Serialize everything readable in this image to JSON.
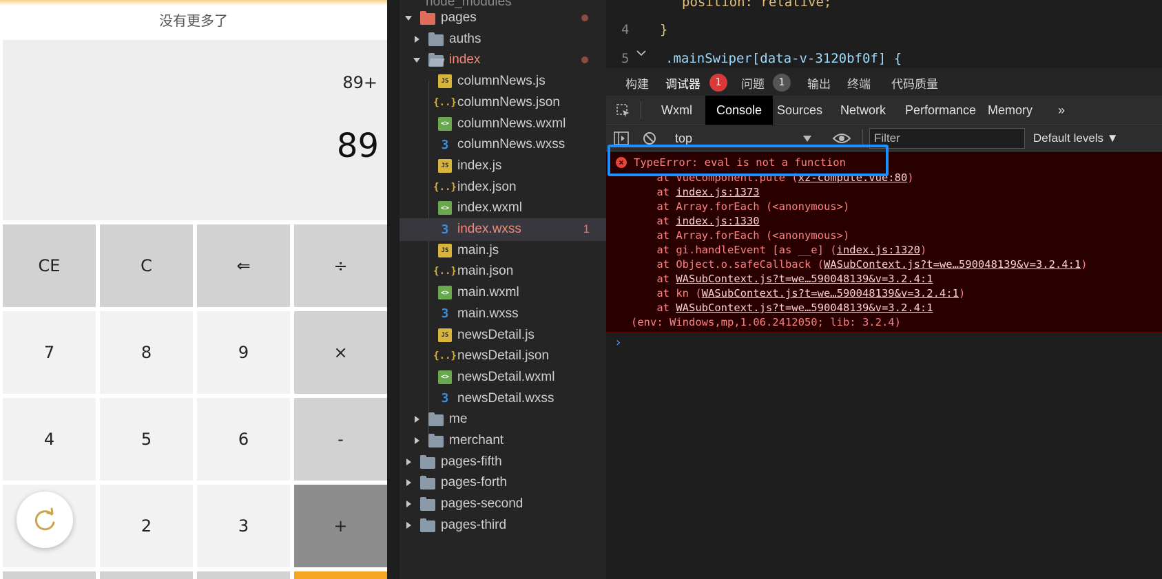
{
  "phone": {
    "no_more": "没有更多了",
    "expression": "89+",
    "result": "89",
    "keys": [
      {
        "label": "CE",
        "type": "fn"
      },
      {
        "label": "C",
        "type": "fn"
      },
      {
        "label": "⇐",
        "type": "fn"
      },
      {
        "label": "÷",
        "type": "op"
      },
      {
        "label": "7",
        "type": "num"
      },
      {
        "label": "8",
        "type": "num"
      },
      {
        "label": "9",
        "type": "num"
      },
      {
        "label": "×",
        "type": "op"
      },
      {
        "label": "4",
        "type": "num"
      },
      {
        "label": "5",
        "type": "num"
      },
      {
        "label": "6",
        "type": "num"
      },
      {
        "label": "-",
        "type": "op"
      },
      {
        "label": "",
        "type": "num"
      },
      {
        "label": "2",
        "type": "num"
      },
      {
        "label": "3",
        "type": "num"
      },
      {
        "label": "+",
        "type": "plus"
      }
    ],
    "refresh_icon": "refresh-icon"
  },
  "tree": {
    "items": [
      {
        "label": "pages",
        "kind": "folder-red",
        "depth": 1,
        "arrow": "down",
        "dot": true
      },
      {
        "label": "auths",
        "kind": "folder",
        "depth": 2,
        "arrow": "right"
      },
      {
        "label": "index",
        "kind": "folder-open",
        "depth": 2,
        "arrow": "down",
        "dot": true,
        "red": true
      },
      {
        "label": "columnNews.js",
        "kind": "js",
        "depth": 3
      },
      {
        "label": "columnNews.json",
        "kind": "json",
        "depth": 3
      },
      {
        "label": "columnNews.wxml",
        "kind": "wxml",
        "depth": 3
      },
      {
        "label": "columnNews.wxss",
        "kind": "wxss",
        "depth": 3
      },
      {
        "label": "index.js",
        "kind": "js",
        "depth": 3
      },
      {
        "label": "index.json",
        "kind": "json",
        "depth": 3
      },
      {
        "label": "index.wxml",
        "kind": "wxml",
        "depth": 3
      },
      {
        "label": "index.wxss",
        "kind": "wxss",
        "depth": 3,
        "selected": true,
        "red": true,
        "count": "1"
      },
      {
        "label": "main.js",
        "kind": "js",
        "depth": 3
      },
      {
        "label": "main.json",
        "kind": "json",
        "depth": 3
      },
      {
        "label": "main.wxml",
        "kind": "wxml",
        "depth": 3
      },
      {
        "label": "main.wxss",
        "kind": "wxss",
        "depth": 3
      },
      {
        "label": "newsDetail.js",
        "kind": "js",
        "depth": 3
      },
      {
        "label": "newsDetail.json",
        "kind": "json",
        "depth": 3
      },
      {
        "label": "newsDetail.wxml",
        "kind": "wxml",
        "depth": 3
      },
      {
        "label": "newsDetail.wxss",
        "kind": "wxss",
        "depth": 3
      },
      {
        "label": "me",
        "kind": "folder",
        "depth": 2,
        "arrow": "right"
      },
      {
        "label": "merchant",
        "kind": "folder",
        "depth": 2,
        "arrow": "right"
      },
      {
        "label": "pages-fifth",
        "kind": "folder",
        "depth": 1,
        "arrow": "right"
      },
      {
        "label": "pages-forth",
        "kind": "folder",
        "depth": 1,
        "arrow": "right"
      },
      {
        "label": "pages-second",
        "kind": "folder",
        "depth": 1,
        "arrow": "right"
      },
      {
        "label": "pages-third",
        "kind": "folder",
        "depth": 1,
        "arrow": "right"
      }
    ]
  },
  "editor": {
    "lines": [
      {
        "num": "4",
        "text": "}"
      },
      {
        "num": "5",
        "text": ".mainSwiper[data-v-3120bf0f] {"
      }
    ],
    "top_partial": "position: relative;"
  },
  "panel_tabs": [
    {
      "label": "构建"
    },
    {
      "label": "调试器",
      "badge": "1",
      "badge_color": "#d73a3a",
      "active": true
    },
    {
      "label": "问题",
      "badge": "1",
      "badge_color": "#555555"
    },
    {
      "label": "输出"
    },
    {
      "label": "终端"
    },
    {
      "label": "代码质量"
    }
  ],
  "devtools": {
    "tabs": [
      "Wxml",
      "Console",
      "Sources",
      "Network",
      "Performance",
      "Memory"
    ],
    "active_tab": "Console",
    "more": "»",
    "context": "top",
    "filter_placeholder": "Filter",
    "levels": "Default levels ▼"
  },
  "console": {
    "error_title": "TypeError: eval is not a function",
    "stack": [
      {
        "prefix": "    at VueComponent.pute (",
        "link": "xz-compute.vue:80",
        "suffix": ")"
      },
      {
        "prefix": "    at ",
        "link": "index.js:1373",
        "suffix": ""
      },
      {
        "prefix": "    at Array.forEach (<anonymous>)",
        "link": "",
        "suffix": ""
      },
      {
        "prefix": "    at ",
        "link": "index.js:1330",
        "suffix": ""
      },
      {
        "prefix": "    at Array.forEach (<anonymous>)",
        "link": "",
        "suffix": ""
      },
      {
        "prefix": "    at gi.handleEvent [as __e] (",
        "link": "index.js:1320",
        "suffix": ")"
      },
      {
        "prefix": "    at Object.o.safeCallback (",
        "link": "WASubContext.js?t=we…590048139&v=3.2.4:1",
        "suffix": ")"
      },
      {
        "prefix": "    at ",
        "link": "WASubContext.js?t=we…590048139&v=3.2.4:1",
        "suffix": ""
      },
      {
        "prefix": "    at kn (",
        "link": "WASubContext.js?t=we…590048139&v=3.2.4:1",
        "suffix": ")"
      },
      {
        "prefix": "    at ",
        "link": "WASubContext.js?t=we…590048139&v=3.2.4:1",
        "suffix": ""
      }
    ],
    "env": "(env: Windows,mp,1.06.2412050; lib: 3.2.4)",
    "prompt": "›"
  }
}
